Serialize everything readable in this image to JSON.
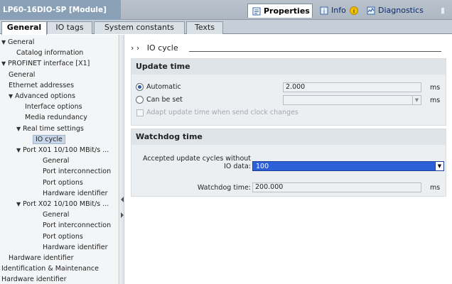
{
  "window": {
    "title": "LP60-16DIO-SP [Module]"
  },
  "top_tabs": [
    {
      "label": "Properties",
      "icon": "properties-icon"
    },
    {
      "label": "Info",
      "icon": "info-icon"
    },
    {
      "label": "Diagnostics",
      "icon": "diagnostics-icon"
    }
  ],
  "tabs": [
    "General",
    "IO tags",
    "System constants",
    "Texts"
  ],
  "tree": [
    {
      "label": "General",
      "level": 0,
      "arrow": "▼"
    },
    {
      "label": "Catalog information",
      "level": 2,
      "arrow": ""
    },
    {
      "label": "PROFINET interface [X1]",
      "level": 0,
      "arrow": "▼"
    },
    {
      "label": "General",
      "level": 1,
      "arrow": ""
    },
    {
      "label": "Ethernet addresses",
      "level": 1,
      "arrow": ""
    },
    {
      "label": "Advanced options",
      "level": 1,
      "arrow": "▼"
    },
    {
      "label": "Interface options",
      "level": 3,
      "arrow": ""
    },
    {
      "label": "Media redundancy",
      "level": 3,
      "arrow": ""
    },
    {
      "label": "Real time settings",
      "level": 2,
      "arrow": "▼"
    },
    {
      "label": "IO cycle",
      "level": 4,
      "arrow": "",
      "selected": true
    },
    {
      "label": "Port X01 10/100 MBit/s ...",
      "level": 2,
      "arrow": "▼"
    },
    {
      "label": "General",
      "level": 5,
      "arrow": ""
    },
    {
      "label": "Port interconnection",
      "level": 5,
      "arrow": ""
    },
    {
      "label": "Port options",
      "level": 5,
      "arrow": ""
    },
    {
      "label": "Hardware identifier",
      "level": 5,
      "arrow": ""
    },
    {
      "label": "Port X02 10/100 MBit/s ...",
      "level": 2,
      "arrow": "▼"
    },
    {
      "label": "General",
      "level": 5,
      "arrow": ""
    },
    {
      "label": "Port interconnection",
      "level": 5,
      "arrow": ""
    },
    {
      "label": "Port options",
      "level": 5,
      "arrow": ""
    },
    {
      "label": "Hardware identifier",
      "level": 5,
      "arrow": ""
    },
    {
      "label": "Hardware identifier",
      "level": 1,
      "arrow": ""
    },
    {
      "label": "Identification & Maintenance",
      "level": 0,
      "arrow": ""
    },
    {
      "label": "Hardware identifier",
      "level": 0,
      "arrow": ""
    }
  ],
  "breadcrumb": {
    "prefix": "› ›",
    "label": "IO cycle"
  },
  "update_time": {
    "title": "Update time",
    "automatic_label": "Automatic",
    "automatic_value": "2.000",
    "automatic_unit": "ms",
    "can_be_set_label": "Can be set",
    "can_be_set_value": "",
    "can_be_set_unit": "ms",
    "adapt_label": "Adapt update time when send clock changes"
  },
  "watchdog_time": {
    "title": "Watchdog time",
    "accepted_label_line1": "Accepted update cycles without",
    "accepted_label_line2": "IO data:",
    "accepted_value": "100",
    "watchdog_label": "Watchdog time:",
    "watchdog_value": "200.000",
    "watchdog_unit": "ms"
  }
}
